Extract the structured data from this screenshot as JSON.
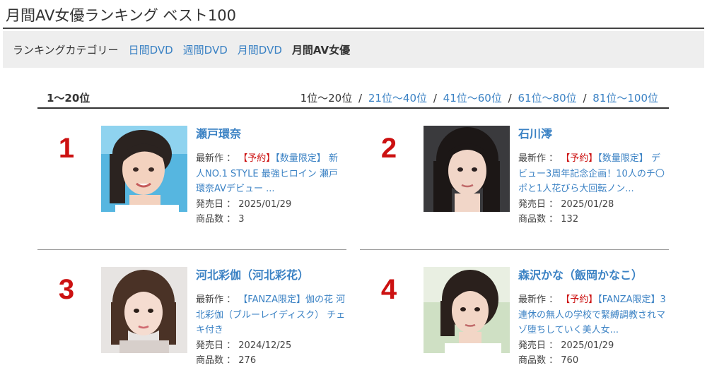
{
  "page": {
    "title": "月間AV女優ランキング ベスト100"
  },
  "category_bar": {
    "label": "ランキングカテゴリー",
    "links": [
      "日間DVD",
      "週間DVD",
      "月間DVD"
    ],
    "current": "月間AV女優"
  },
  "range": {
    "title": "1〜20位",
    "current": "1位〜20位",
    "links": [
      "21位〜40位",
      "41位〜60位",
      "61位〜80位",
      "81位〜100位"
    ],
    "separator": "/"
  },
  "labels": {
    "latest": "最新作 ：",
    "release": "発売日 ：",
    "count": "商品数 ："
  },
  "colors": {
    "link": "#3b82c4",
    "rank": "#cc1111",
    "tag_reserve": "#cc1111"
  },
  "actresses": [
    {
      "rank": "1",
      "name": "瀬戸環奈",
      "tags": [
        {
          "text": "【予約】",
          "color": "red"
        },
        {
          "text": "【数量限定】",
          "color": "blue"
        }
      ],
      "product": "新人NO.1 STYLE 最強ヒロイン 瀬戸環奈AVデビュー ...",
      "release_date": "2025/01/29",
      "count": "3"
    },
    {
      "rank": "2",
      "name": "石川澪",
      "tags": [
        {
          "text": "【予約】",
          "color": "red"
        },
        {
          "text": "【数量限定】",
          "color": "blue"
        }
      ],
      "product": "デビュー3周年記念企画！10人のチ〇ポと1人花びら大回転ノン...",
      "release_date": "2025/01/28",
      "count": "132"
    },
    {
      "rank": "3",
      "name": "河北彩伽（河北彩花）",
      "tags": [
        {
          "text": "【FANZA限定】",
          "color": "blue"
        }
      ],
      "product": "伽の花 河北彩伽（ブルーレイディスク） チェキ付き",
      "release_date": "2024/12/25",
      "count": "276"
    },
    {
      "rank": "4",
      "name": "森沢かな（飯岡かなこ）",
      "tags": [
        {
          "text": "【予約】",
          "color": "red"
        },
        {
          "text": "【FANZA限定】",
          "color": "blue"
        }
      ],
      "product": "3連休の無人の学校で緊縛調教されマゾ堕ちしていく美人女...",
      "release_date": "2025/01/29",
      "count": "760"
    }
  ]
}
